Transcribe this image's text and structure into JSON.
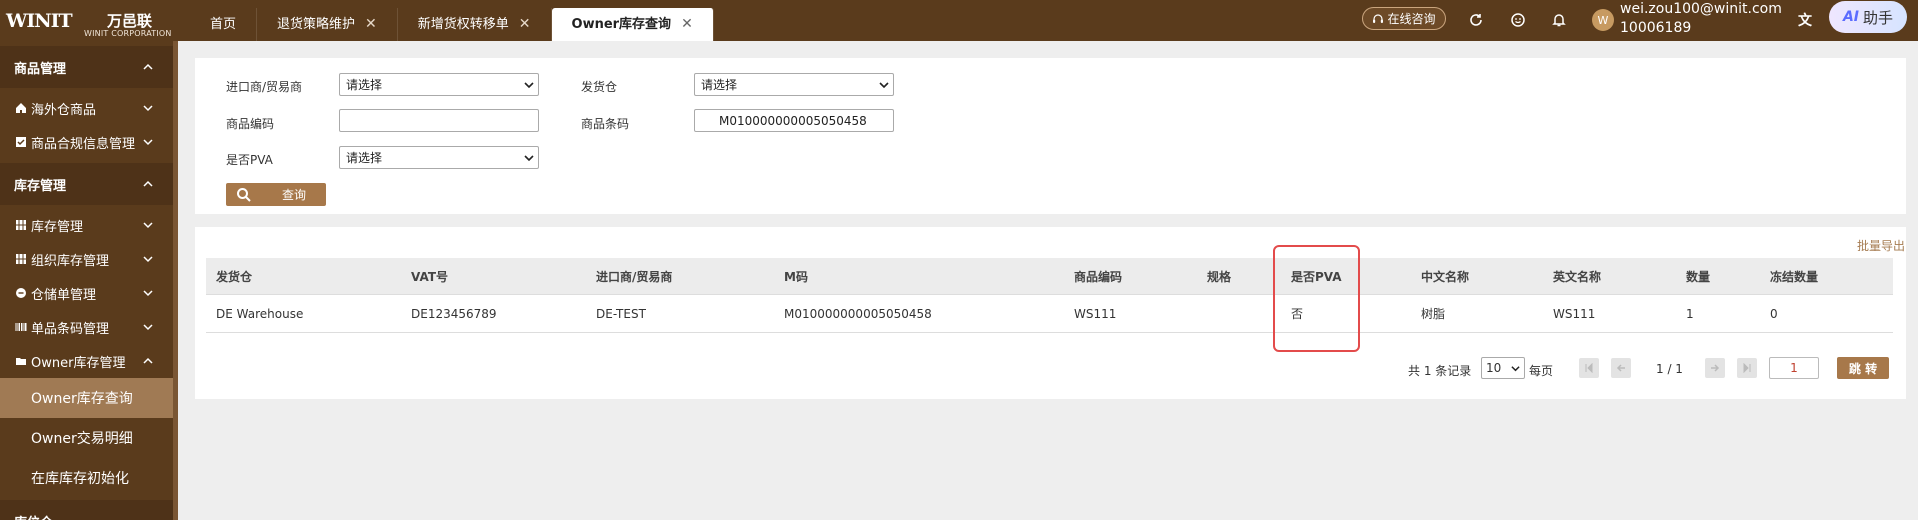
{
  "brand": {
    "logo_mark": "WINIT",
    "logo_cn": "万邑联",
    "logo_en": "WINIT CORPORATION"
  },
  "tabs": [
    {
      "label": "首页",
      "closable": false,
      "active": false
    },
    {
      "label": "退货策略维护",
      "closable": true,
      "active": false
    },
    {
      "label": "新增货权转移单",
      "closable": true,
      "active": false
    },
    {
      "label": "Owner库存查询",
      "closable": true,
      "active": true
    }
  ],
  "header": {
    "online_consult": "在线咨询",
    "avatar_letter": "W",
    "user_email": "wei.zou100@winit.com",
    "user_id": "10006189",
    "ai_label": "AI",
    "ai_text": "助手"
  },
  "sidebar": {
    "section_goods": "商品管理",
    "item_overseas": "海外仓商品",
    "item_compliance": "商品合规信息管理",
    "section_inventory": "库存管理",
    "item_inventory": "库存管理",
    "item_org_inventory": "组织库存管理",
    "item_warehouse_order": "仓储单管理",
    "item_barcode": "单品条码管理",
    "item_owner": "Owner库存管理",
    "sub_owner_query": "Owner库存查询",
    "sub_owner_tx": "Owner交易明细",
    "sub_init": "在库库存初始化",
    "section_partial": "库位仓"
  },
  "filters": {
    "importer_label": "进口商/贸易商",
    "importer_value": "请选择",
    "warehouse_label": "发货仓",
    "warehouse_value": "请选择",
    "product_code_label": "商品编码",
    "product_code_value": "",
    "barcode_label": "商品条码",
    "barcode_value": "M010000000005050458",
    "pva_label": "是否PVA",
    "pva_value": "请选择",
    "query_button": "查询"
  },
  "results": {
    "export_label": "批量导出",
    "columns": [
      "发货仓",
      "VAT号",
      "进口商/贸易商",
      "M码",
      "商品编码",
      "规格",
      "是否PVA",
      "中文名称",
      "英文名称",
      "数量",
      "冻结数量"
    ],
    "rows": [
      [
        "DE Warehouse",
        "DE123456789",
        "DE-TEST",
        "M010000000005050458",
        "WS111",
        "",
        "否",
        "树脂",
        "WS111",
        "1",
        "0"
      ]
    ]
  },
  "pagination": {
    "total_text": "共 1 条记录",
    "page_size": "10",
    "per_page_label": "每页",
    "page_indicator": "1 / 1",
    "goto_value": "1",
    "jump_label": "跳 转"
  },
  "colors": {
    "brand_brown": "#5a3b1c",
    "accent": "#a7784a",
    "highlight_red": "#e34b4b"
  }
}
